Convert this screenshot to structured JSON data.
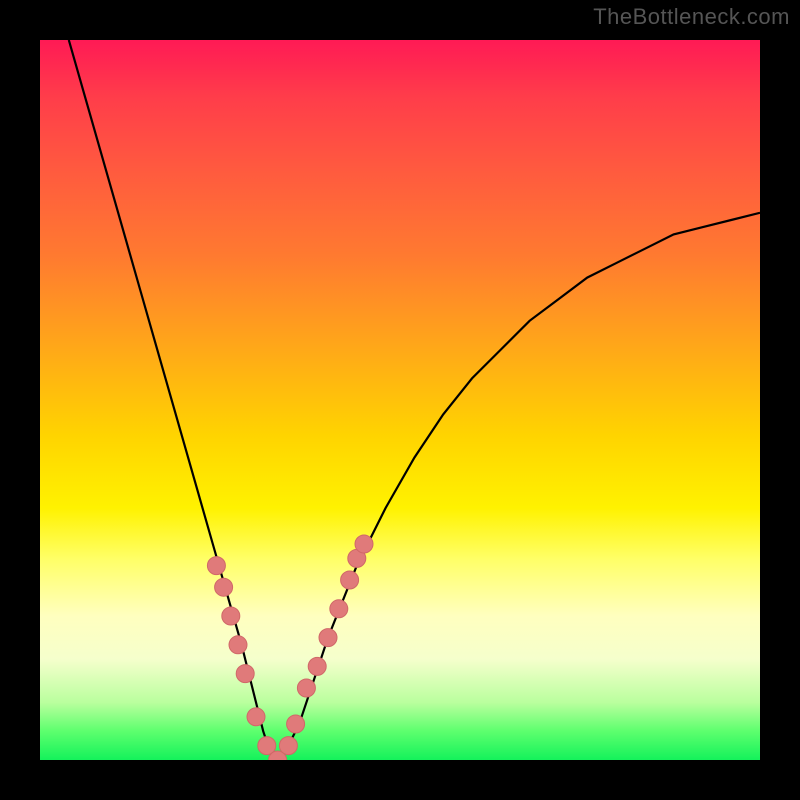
{
  "watermark": "TheBottleneck.com",
  "colors": {
    "frame_background": "#000000",
    "gradient_top": "#ff1a55",
    "gradient_mid": "#ffd400",
    "gradient_bottom": "#14f25b",
    "curve": "#000000",
    "dots": "#e07a7a"
  },
  "chart_data": {
    "type": "line",
    "title": "",
    "xlabel": "",
    "ylabel": "",
    "x_range": [
      0,
      100
    ],
    "y_range": [
      0,
      100
    ],
    "ylim": [
      0,
      100
    ],
    "series": [
      {
        "name": "bottleneck-curve",
        "x": [
          4,
          6,
          8,
          10,
          12,
          14,
          16,
          18,
          20,
          22,
          24,
          26,
          28,
          30,
          31,
          32,
          33,
          34,
          36,
          38,
          40,
          44,
          48,
          52,
          56,
          60,
          64,
          68,
          72,
          76,
          80,
          84,
          88,
          92,
          96,
          100
        ],
        "y": [
          100,
          93,
          86,
          79,
          72,
          65,
          58,
          51,
          44,
          37,
          30,
          23,
          16,
          8,
          4,
          1,
          0,
          1,
          5,
          11,
          17,
          27,
          35,
          42,
          48,
          53,
          57,
          61,
          64,
          67,
          69,
          71,
          73,
          74,
          75,
          76
        ]
      }
    ],
    "highlight_points": {
      "name": "pink-dots",
      "x": [
        24.5,
        25.5,
        26.5,
        27.5,
        28.5,
        30.0,
        31.5,
        33.0,
        34.5,
        35.5,
        37.0,
        38.5,
        40.0,
        41.5,
        43.0,
        44.0,
        45.0
      ],
      "y": [
        27,
        24,
        20,
        16,
        12,
        6,
        2,
        0,
        2,
        5,
        10,
        13,
        17,
        21,
        25,
        28,
        30
      ]
    },
    "annotations": []
  }
}
